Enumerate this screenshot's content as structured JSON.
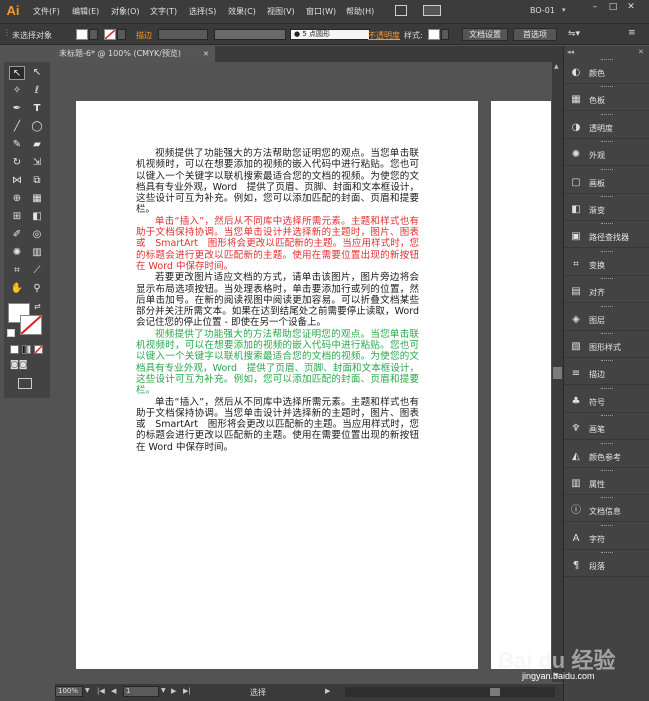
{
  "app": {
    "logo": "Ai",
    "workspace": "BO-01"
  },
  "menu": [
    "文件(F)",
    "编辑(E)",
    "对象(O)",
    "文字(T)",
    "选择(S)",
    "效果(C)",
    "视图(V)",
    "窗口(W)",
    "帮助(H)"
  ],
  "window_controls": {
    "minimize": "–",
    "maximize": "□",
    "close": "✕"
  },
  "control_bar": {
    "selection": "未选择对象",
    "stroke_label": "描边",
    "stroke_value": "",
    "brush_value": "5 点圆形",
    "opacity_label": "不透明度",
    "style_label": "样式:",
    "doc_settings": "文档设置",
    "preferences": "首选项",
    "accent_color": "#f29a2e"
  },
  "document_tab": {
    "title": "未标题-6* @ 100% (CMYK/预览)",
    "close": "✕"
  },
  "document": {
    "paragraphs": [
      {
        "color": "black",
        "text": "视频提供了功能强大的方法帮助您证明您的观点。当您单击联机视频时，可以在想要添加的视频的嵌入代码中进行粘贴。您也可以键入一个关键字以联机搜索最适合您的文档的视频。为使您的文档具有专业外观，Word　提供了页眉、页脚、封面和文本框设计，这些设计可互为补充。例如，您可以添加匹配的封面、页眉和提要栏。"
      },
      {
        "color": "red",
        "text": "单击“插入”，然后从不同库中选择所需元素。主题和样式也有助于文档保持协调。当您单击设计并选择新的主题时，图片、图表或　SmartArt　图形将会更改以匹配新的主题。当应用样式时，您的标题会进行更改以匹配新的主题。使用在需要位置出现的新按钮在 Word 中保存时间。"
      },
      {
        "color": "black",
        "text": "若要更改图片适应文档的方式，请单击该图片，图片旁边将会显示布局选项按钮。当处理表格时，单击要添加行或列的位置，然后单击加号。在新的阅读视图中阅读更加容易。可以折叠文档某些部分并关注所需文本。如果在达到结尾处之前需要停止读取，Word 会记住您的停止位置 - 即使在另一个设备上。"
      },
      {
        "color": "green",
        "text": "视频提供了功能强大的方法帮助您证明您的观点。当您单击联机视频时，可以在想要添加的视频的嵌入代码中进行粘贴。您也可以键入一个关键字以联机搜索最适合您的文档的视频。为使您的文档具有专业外观，Word　提供了页眉、页脚、封面和文本框设计，这些设计可互为补充。例如，您可以添加匹配的封面、页眉和提要栏。"
      },
      {
        "color": "black",
        "text": "单击“插入”，然后从不同库中选择所需元素。主题和样式也有助于文档保持协调。当您单击设计并选择新的主题时，图片、图表或　SmartArt　图形将会更改以匹配新的主题。当应用样式时，您的标题会进行更改以匹配新的主题。使用在需要位置出现的新按钮在 Word 中保存时间。"
      }
    ]
  },
  "status_bar": {
    "zoom": "100%",
    "page": "1",
    "tool": "选择"
  },
  "panels": [
    {
      "label": "颜色",
      "icon": "color-icon"
    },
    {
      "label": "色板",
      "icon": "swatches-icon"
    },
    {
      "label": "透明度",
      "icon": "transparency-icon"
    },
    {
      "label": "外观",
      "icon": "appearance-icon"
    },
    {
      "label": "画板",
      "icon": "artboards-icon"
    },
    {
      "label": "渐变",
      "icon": "gradient-icon"
    },
    {
      "label": "路径查找器",
      "icon": "pathfinder-icon"
    },
    {
      "label": "变换",
      "icon": "transform-icon"
    },
    {
      "label": "对齐",
      "icon": "align-icon"
    },
    {
      "label": "图层",
      "icon": "layers-icon"
    },
    {
      "label": "图形样式",
      "icon": "graphic-styles-icon"
    },
    {
      "label": "描边",
      "icon": "stroke-icon"
    },
    {
      "label": "符号",
      "icon": "symbols-icon"
    },
    {
      "label": "画笔",
      "icon": "brushes-icon"
    },
    {
      "label": "颜色参考",
      "icon": "color-guide-icon"
    },
    {
      "label": "属性",
      "icon": "attributes-icon"
    },
    {
      "label": "文档信息",
      "icon": "document-info-icon"
    },
    {
      "label": "字符",
      "icon": "character-icon"
    },
    {
      "label": "段落",
      "icon": "paragraph-icon"
    }
  ],
  "watermark": {
    "brand": "Bai du 经验",
    "url": "jingyan.baidu.com"
  }
}
